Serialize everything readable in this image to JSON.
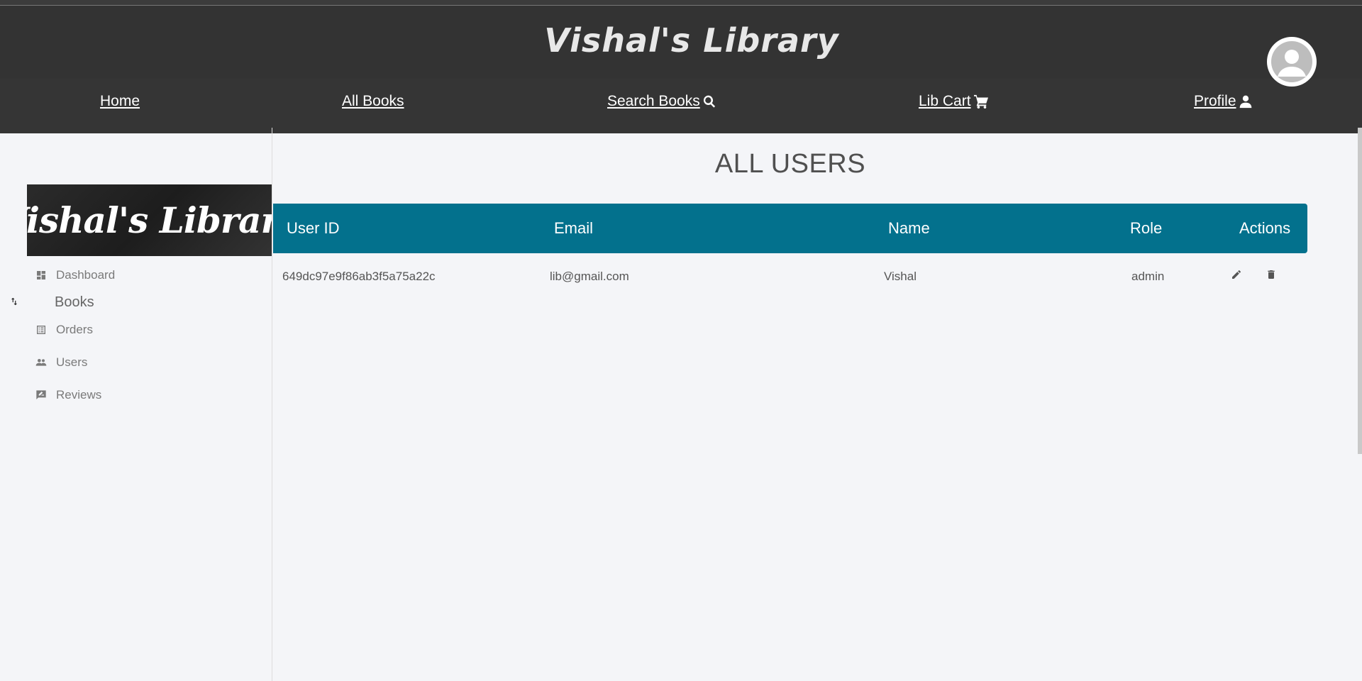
{
  "header": {
    "site_title": "Vishal's Library",
    "nav": [
      {
        "label": "Home",
        "icon": ""
      },
      {
        "label": "All Books",
        "icon": ""
      },
      {
        "label": "Search Books",
        "icon": "search-icon"
      },
      {
        "label": "Lib Cart ",
        "icon": "cart-icon"
      },
      {
        "label": "Profile ",
        "icon": "user-icon"
      }
    ],
    "avatar_icon": "account-circle-icon"
  },
  "sidebar": {
    "logo_text": "Vishal's Library",
    "items": [
      {
        "label": "Dashboard",
        "icon": "dashboard-icon"
      },
      {
        "label": "Books",
        "icon": "swap-vert-icon"
      },
      {
        "label": "Orders",
        "icon": "list-alt-icon"
      },
      {
        "label": "Users",
        "icon": "people-icon"
      },
      {
        "label": "Reviews",
        "icon": "rate-review-icon"
      }
    ]
  },
  "main": {
    "title": "ALL USERS",
    "table": {
      "headers": [
        "User ID",
        "Email",
        "Name",
        "Role",
        "Actions"
      ],
      "rows": [
        {
          "id": "649dc97e9f86ab3f5a75a22c",
          "email": "lib@gmail.com",
          "name": "Vishal",
          "role": "admin",
          "actions": [
            "edit-icon",
            "delete-icon"
          ]
        }
      ]
    }
  },
  "colors": {
    "header_bg": "#333333",
    "table_header_bg": "#03718d",
    "page_bg": "#f4f5f8"
  }
}
